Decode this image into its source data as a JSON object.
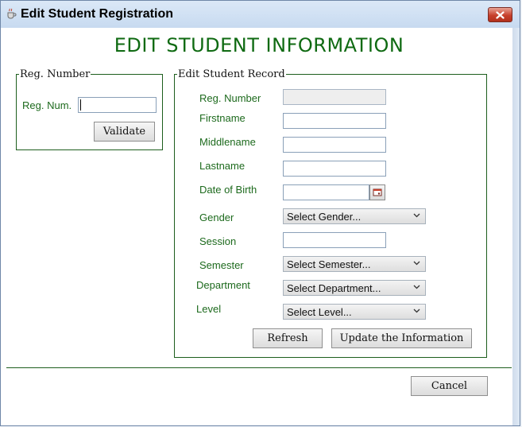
{
  "window": {
    "title": "Edit Student Registration"
  },
  "heading": "EDIT STUDENT INFORMATION",
  "reg_panel": {
    "legend": "Reg. Number",
    "label": "Reg. Num.",
    "value": "",
    "validate_label": "Validate"
  },
  "record_panel": {
    "legend": "Edit Student Record",
    "fields": {
      "reg_number": {
        "label": "Reg. Number",
        "value": ""
      },
      "firstname": {
        "label": "Firstname",
        "value": ""
      },
      "middlename": {
        "label": "Middlename",
        "value": ""
      },
      "lastname": {
        "label": "Lastname",
        "value": ""
      },
      "dob": {
        "label": "Date of Birth",
        "value": ""
      },
      "gender": {
        "label": "Gender",
        "selected": "Select Gender..."
      },
      "session": {
        "label": "Session",
        "value": ""
      },
      "semester": {
        "label": "Semester",
        "selected": "Select Semester..."
      },
      "department": {
        "label": "Department",
        "selected": "Select Department..."
      },
      "level": {
        "label": "Level",
        "selected": "Select Level..."
      }
    },
    "refresh_label": "Refresh",
    "update_label": "Update the Information"
  },
  "cancel_label": "Cancel",
  "colors": {
    "accent_green": "#0f6a12",
    "label_green": "#1d6a1d",
    "close_red": "#c7402c"
  }
}
